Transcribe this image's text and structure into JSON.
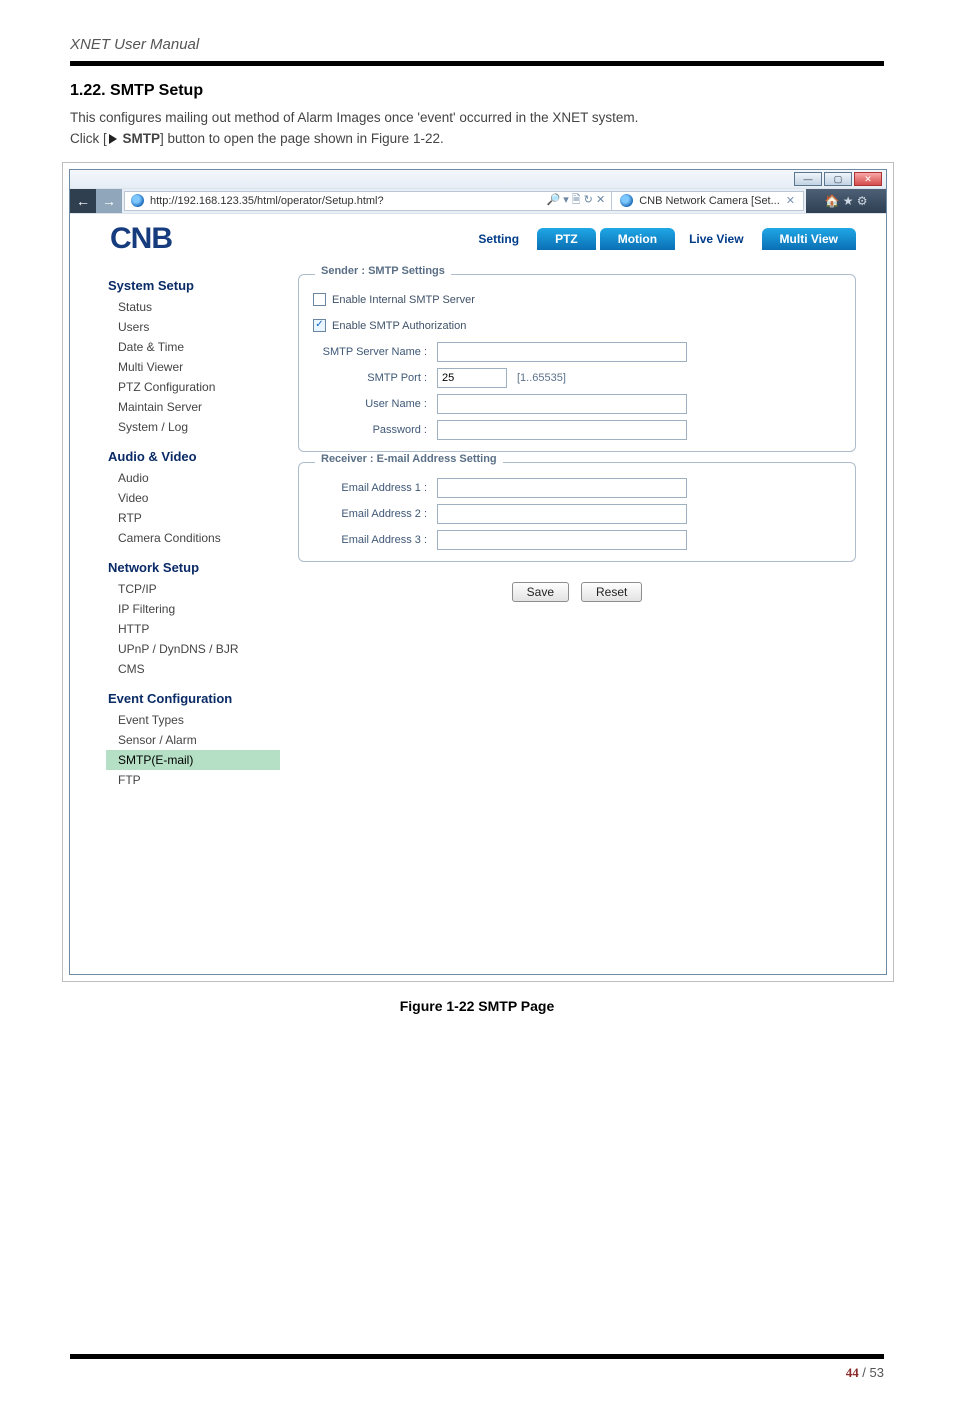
{
  "doc": {
    "header": "XNET User Manual",
    "section_number": "1.22.",
    "section_name": "SMTP Setup",
    "body_line1": "This configures mailing out method of Alarm Images once 'event' occurred in the XNET system.",
    "body_line2_a": "Click [",
    "body_line2_b": " SMTP",
    "body_line2_c": "] button to open the page shown in Figure 1-22.",
    "figure_caption": "Figure 1-22 SMTP Page",
    "page_current": "44",
    "page_sep": " / ",
    "page_total": "53"
  },
  "browser": {
    "url_display": "http://192.168.123.35/html/operator/Setup.html?",
    "url_icons": "🔎 ▾ 🗎 ↻ ✕",
    "tab_title": "CNB Network Camera [Set...",
    "tab_close": "✕",
    "win_min": "—",
    "win_max": "▢",
    "win_close": "✕",
    "right_icons": "🏠 ★ ⚙"
  },
  "topnav": {
    "logo": "CNB",
    "links": {
      "setting": "Setting",
      "liveview": "Live View"
    },
    "tabs": {
      "ptz": "PTZ",
      "motion": "Motion",
      "multiview": "Multi View"
    }
  },
  "sidenav": {
    "system_setup": "System Setup",
    "status": "Status",
    "users": "Users",
    "datetime": "Date & Time",
    "multiviewer": "Multi Viewer",
    "ptzcfg": "PTZ Configuration",
    "maintain": "Maintain Server",
    "syslog": "System / Log",
    "audio_video": "Audio & Video",
    "audio": "Audio",
    "video": "Video",
    "rtp": "RTP",
    "camcond": "Camera Conditions",
    "network_setup": "Network Setup",
    "tcpip": "TCP/IP",
    "ipfilter": "IP Filtering",
    "http": "HTTP",
    "upnp": "UPnP / DynDNS / BJR",
    "cms": "CMS",
    "event_cfg": "Event Configuration",
    "evtypes": "Event Types",
    "sensor": "Sensor / Alarm",
    "smtp": "SMTP(E-mail)",
    "ftp": "FTP"
  },
  "smtp": {
    "sender_legend": "Sender : SMTP Settings",
    "enable_internal": "Enable Internal SMTP Server",
    "enable_auth": "Enable SMTP Authorization",
    "server_name_label": "SMTP Server Name :",
    "server_name_value": "",
    "port_label": "SMTP Port :",
    "port_value": "25",
    "port_hint": "[1..65535]",
    "user_label": "User Name :",
    "user_value": "",
    "pass_label": "Password :",
    "pass_value": "",
    "receiver_legend": "Receiver : E-mail Address Setting",
    "email1_label": "Email Address 1 :",
    "email1_value": "",
    "email2_label": "Email Address 2 :",
    "email2_value": "",
    "email3_label": "Email Address 3 :",
    "email3_value": "",
    "save": "Save",
    "reset": "Reset"
  }
}
